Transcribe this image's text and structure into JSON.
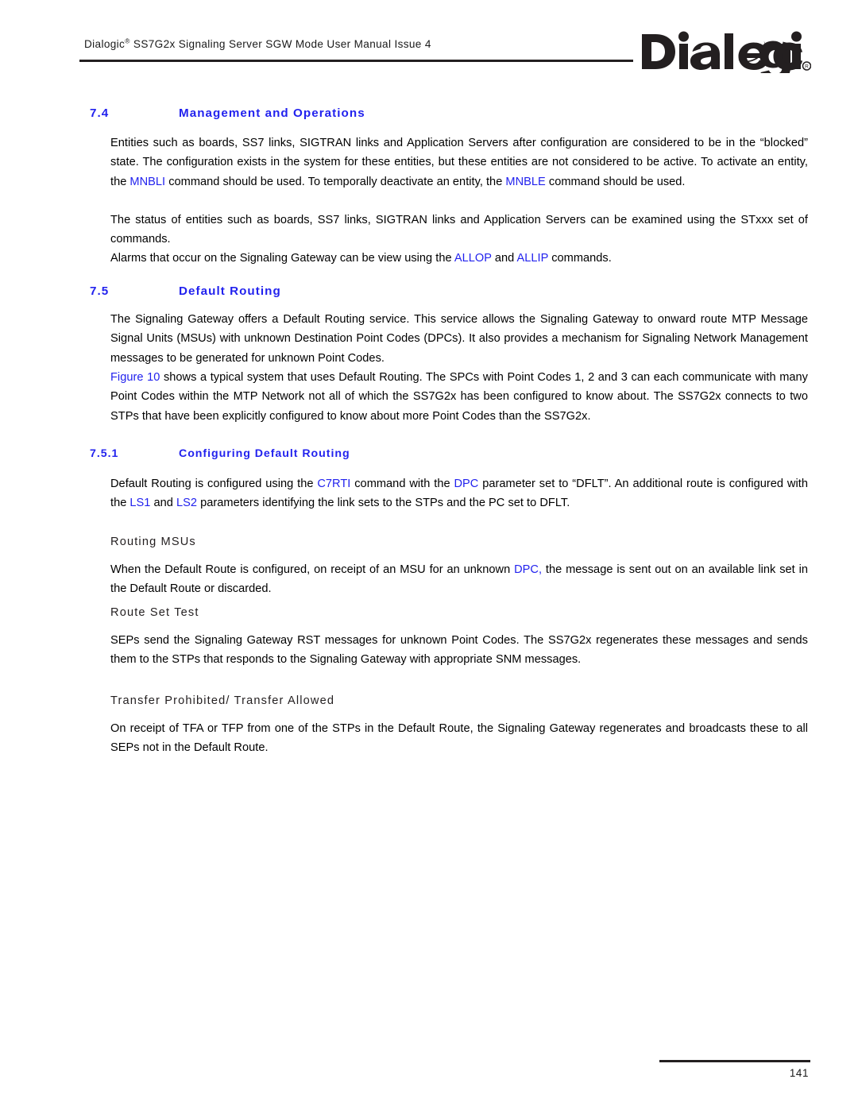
{
  "header": {
    "running_title_prefix": "Dialogic",
    "registered_mark": "®",
    "running_title_suffix": " SS7G2x Signaling Server SGW Mode User Manual  Issue 4",
    "logo_text": "Dialogic",
    "logo_registered": "®"
  },
  "sections": {
    "s74": {
      "number": "7.4",
      "title": "Management and Operations",
      "p1_a": "Entities such as boards, SS7 links, SIGTRAN links and Application Servers after configuration are considered to be in the “blocked” state. The configuration exists in the system for these entities, but these entities are not considered to be active. To activate an entity, the ",
      "p1_link1": "MNBLI",
      "p1_b": " command should be used. To temporally deactivate an entity, the ",
      "p1_link2": "MNBLE",
      "p1_c": " command should be used.",
      "p2": "The status of entities such as boards, SS7 links, SIGTRAN links and Application Servers can be examined using the STxxx set of commands.",
      "p3_a": "Alarms that occur on the Signaling Gateway can be view using the ",
      "p3_link1": "ALLOP",
      "p3_b": " and ",
      "p3_link2": "ALLIP",
      "p3_c": " commands."
    },
    "s75": {
      "number": "7.5",
      "title": "Default Routing",
      "p1": "The Signaling Gateway offers a Default Routing service. This service allows the Signaling Gateway to onward route MTP Message Signal Units (MSUs) with unknown Destination Point Codes (DPCs). It also provides a mechanism for Signaling Network Management messages to be generated for unknown Point Codes.",
      "p2_link1": "Figure 10",
      "p2_a": " shows a typical system that uses Default Routing. The SPCs with Point Codes 1, 2 and 3 can each communicate with many Point Codes within the MTP Network not all of which the SS7G2x has been configured to know about. The SS7G2x connects to two STPs that have been explicitly configured to know about more Point Codes than the SS7G2x."
    },
    "s751": {
      "number": "7.5.1",
      "title": "Configuring Default Routing",
      "p1_a": "Default Routing is configured using the ",
      "p1_link1": "C7RTI",
      "p1_b": " command with the ",
      "p1_link2": "DPC",
      "p1_c": " parameter set to “DFLT”. An additional route is configured with the ",
      "p1_link3": "LS1",
      "p1_d": " and ",
      "p1_link4": "LS2",
      "p1_e": " parameters identifying the link sets to the STPs and the PC set to DFLT."
    },
    "routing_msus": {
      "title": "Routing MSUs",
      "p1_a": "When the Default Route is configured, on receipt of an MSU for an unknown ",
      "p1_link1": "DPC,",
      "p1_b": " the message is sent out on an available link set in the Default Route or discarded."
    },
    "route_set_test": {
      "title": "Route Set Test",
      "p1": "SEPs send the Signaling Gateway RST messages for unknown Point Codes. The SS7G2x regenerates these messages and sends them to the STPs that responds to the Signaling Gateway with appropriate SNM messages."
    },
    "transfer": {
      "title": "Transfer Prohibited/ Transfer Allowed",
      "p1": "On receipt of TFA or TFP from one of the STPs in the Default Route, the Signaling Gateway regenerates and broadcasts these to all SEPs not in the Default Route."
    }
  },
  "footer": {
    "page_number": "141"
  },
  "colors": {
    "heading_blue": "#2222ee",
    "link_blue": "#2222ee",
    "rule_black": "#231f20",
    "body_black": "#000000"
  }
}
